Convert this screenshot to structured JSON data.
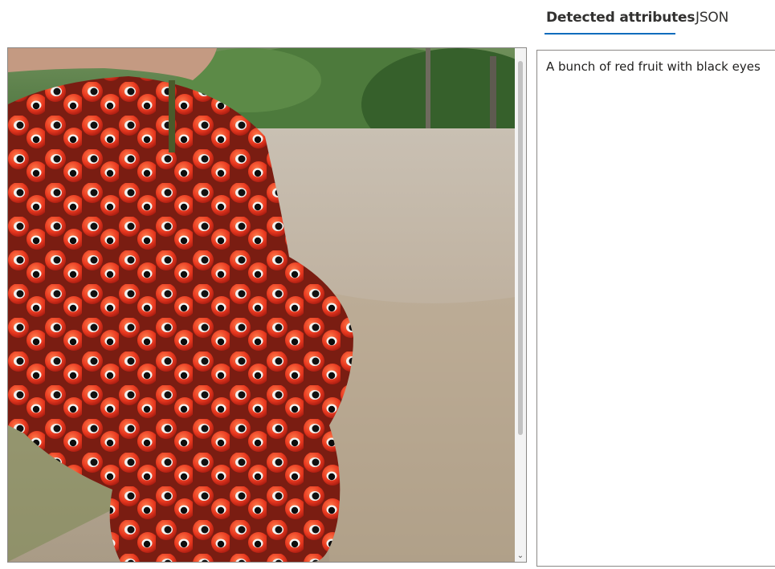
{
  "tabs": {
    "detected_label": "Detected attributes",
    "json_label": "JSON",
    "active": "detected"
  },
  "image_panel": {
    "subject_icon": "fruit-photo",
    "scroll_down_icon": "⌄"
  },
  "attributes": {
    "caption": "A bunch of red fruit with black eyes"
  },
  "colors": {
    "accent": "#0f6cbd",
    "border": "#8a8886",
    "text": "#201f1e"
  }
}
